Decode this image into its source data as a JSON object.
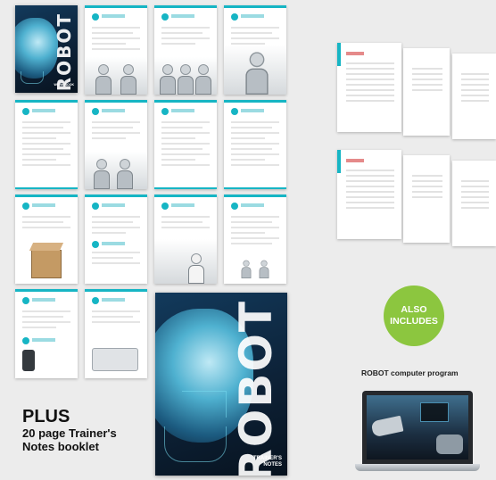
{
  "small_cover": {
    "title": "ROBOT",
    "subtitle": "WORK BOOK"
  },
  "large_cover": {
    "title": "ROBOT",
    "subtitle": "TRAINER'S NOTES"
  },
  "promo": {
    "plus": "PLUS",
    "line1": "20 page Trainer's",
    "line2": "Notes booklet"
  },
  "also_badge": {
    "line1": "ALSO",
    "line2": "INCLUDES"
  },
  "program_label": "ROBOT computer program",
  "colors": {
    "accent": "#16b5c4",
    "badge_green": "#8cc63f",
    "cover_dark": "#0d2238"
  }
}
